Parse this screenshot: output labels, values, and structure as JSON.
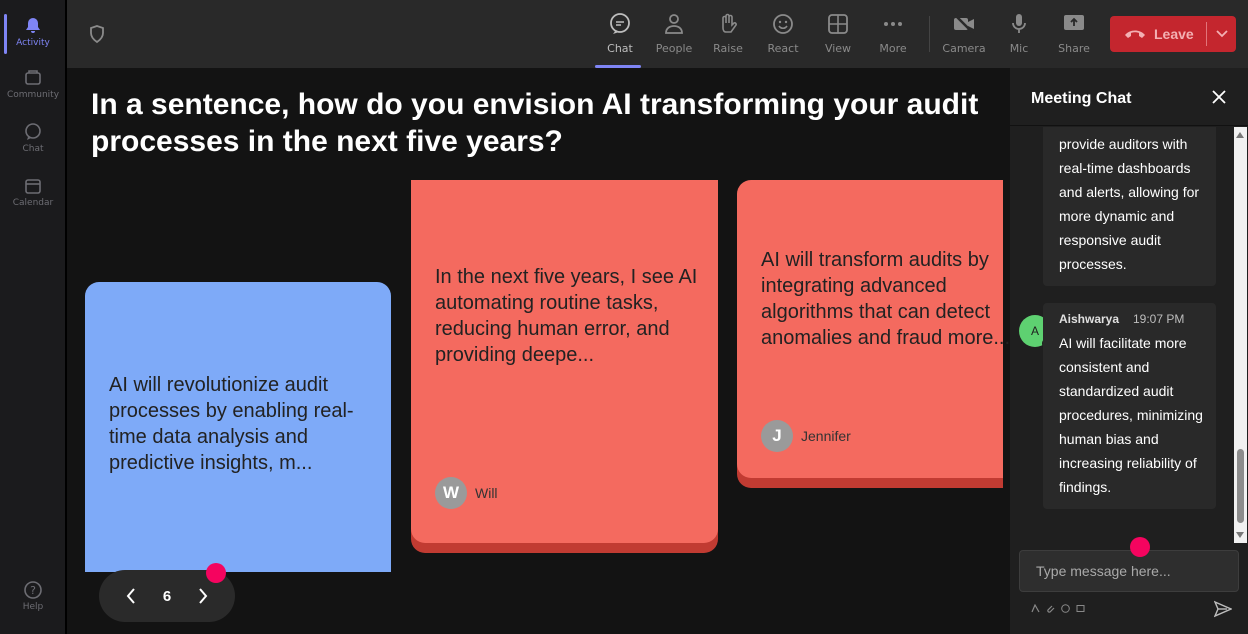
{
  "rail": {
    "items": [
      {
        "label": "Activity"
      },
      {
        "label": "Community"
      },
      {
        "label": "Chat"
      },
      {
        "label": "Calendar"
      }
    ],
    "help_label": "Help"
  },
  "toolbar": {
    "chat": "Chat",
    "people": "People",
    "raise": "Raise",
    "react": "React",
    "view": "View",
    "more": "More",
    "camera": "Camera",
    "mic": "Mic",
    "share": "Share",
    "leave": "Leave"
  },
  "stage": {
    "question": "In a sentence, how do you envision AI transforming your audit processes in the next five years?",
    "cards": [
      {
        "text": "AI will revolutionize audit processes by enabling real-time data analysis and predictive insights, m...",
        "color": "#7eaaf8"
      },
      {
        "text": "In the next five years, I see AI automating routine tasks, reducing human error, and providing deepe...",
        "author": "Will",
        "initial": "W",
        "color": "#f46a5f"
      },
      {
        "text": "AI will transform audits by integrating advanced algorithms that can detect anomalies and fraud more...",
        "author": "Jennifer",
        "initial": "J",
        "color": "#f46a5f"
      }
    ],
    "page": "6"
  },
  "chat": {
    "title": "Meeting Chat",
    "messages": [
      {
        "text": "provide auditors with real-time dashboards and alerts, allowing for more dynamic and responsive audit processes."
      },
      {
        "name": "Aishwarya",
        "time": "19:07 PM",
        "initial": "A",
        "text": "AI will facilitate more consistent and standardized audit procedures, minimizing human bias and increasing reliability of findings."
      }
    ],
    "input_placeholder": "Type message here..."
  },
  "colors": {
    "accent": "#7f85f5",
    "leave": "#c4262e",
    "highlight_dot": "#f5045f"
  }
}
